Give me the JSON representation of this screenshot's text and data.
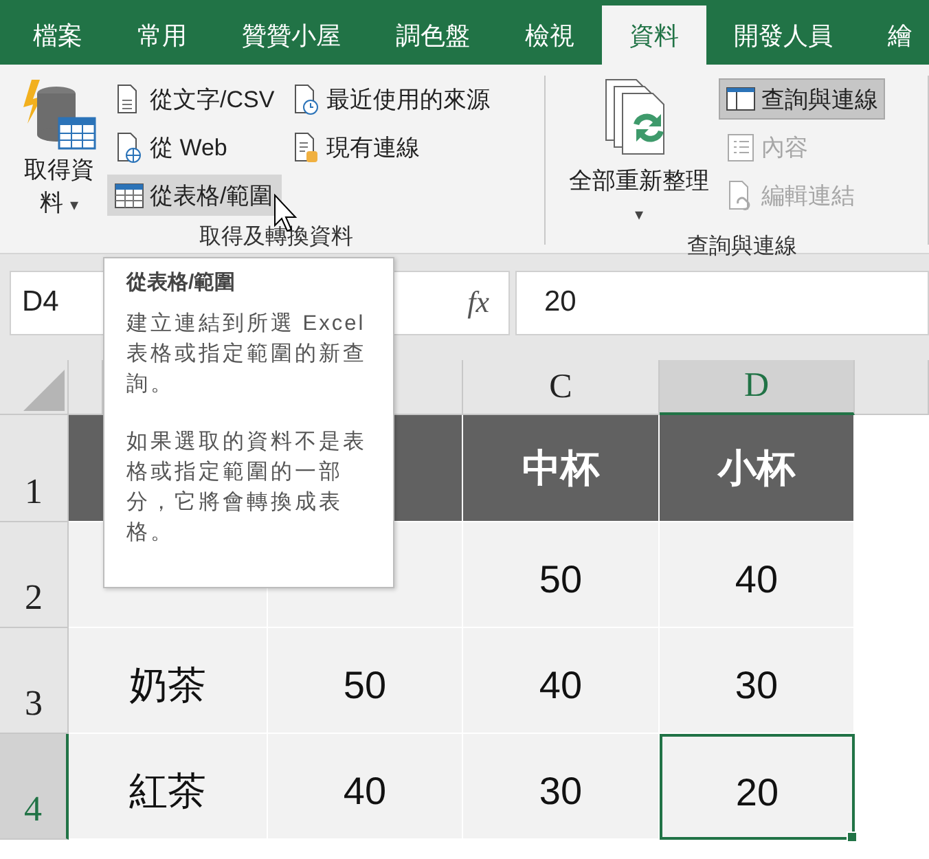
{
  "tabs": [
    {
      "label": "檔案",
      "selected": false
    },
    {
      "label": "常用",
      "selected": false
    },
    {
      "label": "贊贊小屋",
      "selected": false
    },
    {
      "label": "調色盤",
      "selected": false
    },
    {
      "label": "檢視",
      "selected": false
    },
    {
      "label": "資料",
      "selected": true
    },
    {
      "label": "開發人員",
      "selected": false
    },
    {
      "label": "繪",
      "selected": false
    }
  ],
  "ribbon": {
    "groups": [
      {
        "label": "取得及轉換資料",
        "large_button": {
          "label": "取得資料",
          "caret": "▾"
        },
        "columns": [
          [
            {
              "label": "從文字/CSV",
              "highlighted": false,
              "pressed": false,
              "disabled": false
            },
            {
              "label": "從 Web",
              "highlighted": false,
              "pressed": false,
              "disabled": false
            },
            {
              "label": "從表格/範圍",
              "highlighted": true,
              "pressed": false,
              "disabled": false
            }
          ],
          [
            {
              "label": "最近使用的來源",
              "highlighted": false,
              "pressed": false,
              "disabled": false
            },
            {
              "label": "現有連線",
              "highlighted": false,
              "pressed": false,
              "disabled": false
            }
          ]
        ]
      },
      {
        "label": "查詢與連線",
        "large_button": {
          "label": "全部重新整理",
          "caret": "▾"
        },
        "columns": [
          [
            {
              "label": "查詢與連線",
              "highlighted": false,
              "pressed": true,
              "disabled": false
            },
            {
              "label": "內容",
              "highlighted": false,
              "pressed": false,
              "disabled": true
            },
            {
              "label": "編輯連結",
              "highlighted": false,
              "pressed": false,
              "disabled": true
            }
          ]
        ]
      }
    ]
  },
  "formula_bar": {
    "name_box": "D4",
    "function_label": "fx",
    "formula": "20"
  },
  "grid": {
    "columns": [
      {
        "selected": false
      },
      {
        "selected": false
      },
      {
        "label": "C",
        "selected": false
      },
      {
        "label": "D",
        "selected": true
      }
    ],
    "rows": [
      {
        "label": "1",
        "selected": false,
        "kind": "header",
        "cells": [
          {
            "active": false
          },
          {
            "active": false
          },
          {
            "text": "中杯",
            "active": false
          },
          {
            "text": "小杯",
            "active": false
          }
        ]
      },
      {
        "label": "2",
        "selected": false,
        "kind": "data",
        "cells": [
          {
            "active": false
          },
          {
            "active": false
          },
          {
            "text": "50",
            "active": false
          },
          {
            "text": "40",
            "active": false
          }
        ]
      },
      {
        "label": "3",
        "selected": false,
        "kind": "data",
        "cells": [
          {
            "text": "奶茶",
            "active": false
          },
          {
            "text": "50",
            "active": false
          },
          {
            "text": "40",
            "active": false
          },
          {
            "text": "30",
            "active": false
          }
        ]
      },
      {
        "label": "4",
        "selected": true,
        "kind": "data",
        "cells": [
          {
            "text": "紅茶",
            "active": false
          },
          {
            "text": "40",
            "active": false
          },
          {
            "text": "30",
            "active": false
          },
          {
            "text": "20",
            "active": true
          }
        ]
      }
    ]
  },
  "tooltip": {
    "title": "從表格/範圍",
    "paragraphs": [
      "建立連結到所選 Excel 表格或指定範圍的新查詢。",
      "如果選取的資料不是表格或指定範圍的一部分，它將會轉換成表格。"
    ]
  }
}
